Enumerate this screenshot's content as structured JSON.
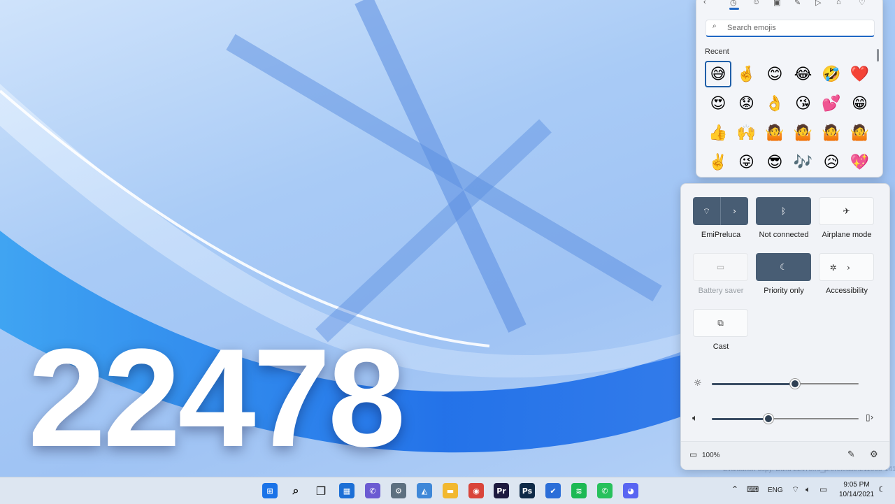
{
  "wallpaper": {
    "overlay_text": "22478"
  },
  "watermark": "Evaluation copy. Build 22478.rs_prerelease.211008-1415",
  "emoji_panel": {
    "tabs": [
      {
        "name": "back-icon",
        "glyph": "‹"
      },
      {
        "name": "recent-tab-icon",
        "glyph": "◷"
      },
      {
        "name": "smileys-tab-icon",
        "glyph": "☺"
      },
      {
        "name": "people-tab-icon",
        "glyph": "▣"
      },
      {
        "name": "celebration-tab-icon",
        "glyph": "✎"
      },
      {
        "name": "food-tab-icon",
        "glyph": "▷"
      },
      {
        "name": "travel-tab-icon",
        "glyph": "⌂"
      },
      {
        "name": "heart-tab-icon",
        "glyph": "♡"
      }
    ],
    "search_placeholder": "Search emojis",
    "section_label": "Recent",
    "emojis": [
      "😅",
      "🤞",
      "😊",
      "😂",
      "🤣",
      "❤️",
      "😍",
      "😟",
      "👌",
      "😘",
      "💕",
      "😁",
      "👍",
      "🙌",
      "🤷",
      "🤷",
      "🤷",
      "🤷",
      "✌️",
      "😜",
      "😎",
      "🎶",
      "😥",
      "💖"
    ]
  },
  "quick_settings": {
    "tiles": [
      {
        "key": "wifi",
        "label": "EmiPreluca",
        "icon": "wifi-icon",
        "glyph": "⌔",
        "state": "on",
        "has_arrow": true
      },
      {
        "key": "bluetooth",
        "label": "Not connected",
        "icon": "bluetooth-icon",
        "glyph": "ᛒ",
        "state": "on",
        "has_arrow": false
      },
      {
        "key": "airplane",
        "label": "Airplane mode",
        "icon": "airplane-icon",
        "glyph": "✈",
        "state": "off",
        "has_arrow": false
      },
      {
        "key": "battery_saver",
        "label": "Battery saver",
        "icon": "battery-saver-icon",
        "glyph": "▭",
        "state": "disabled",
        "has_arrow": false
      },
      {
        "key": "priority",
        "label": "Priority only",
        "icon": "moon-icon",
        "glyph": "☾",
        "state": "on",
        "has_arrow": false
      },
      {
        "key": "accessibility",
        "label": "Accessibility",
        "icon": "accessibility-icon",
        "glyph": "✲",
        "state": "off",
        "has_arrow": true
      },
      {
        "key": "cast",
        "label": "Cast",
        "icon": "cast-icon",
        "glyph": "⧉",
        "state": "off",
        "has_arrow": false
      }
    ],
    "brightness_level": 0.56,
    "volume_level": 0.38,
    "battery_text": "100%"
  },
  "taskbar": {
    "apps": [
      {
        "name": "start-button",
        "glyph": "⊞",
        "bg": "#1a73e8"
      },
      {
        "name": "search-icon",
        "glyph": "⌕",
        "bg": ""
      },
      {
        "name": "task-view-icon",
        "glyph": "❐",
        "bg": ""
      },
      {
        "name": "widgets-icon",
        "glyph": "▦",
        "bg": "#1c6fd6"
      },
      {
        "name": "teams-chat-icon",
        "glyph": "✆",
        "bg": "#6b5bd2"
      },
      {
        "name": "settings-icon",
        "glyph": "⚙",
        "bg": "#5d7080"
      },
      {
        "name": "photos-icon",
        "glyph": "◭",
        "bg": "#3f88d8"
      },
      {
        "name": "file-explorer-icon",
        "glyph": "▬",
        "bg": "#f2b82f"
      },
      {
        "name": "chrome-icon",
        "glyph": "◉",
        "bg": "#d9453a"
      },
      {
        "name": "premiere-pro-icon",
        "glyph": "Pr",
        "bg": "#1d1a3f"
      },
      {
        "name": "photoshop-icon",
        "glyph": "Ps",
        "bg": "#0e2a48"
      },
      {
        "name": "todo-icon",
        "glyph": "✔",
        "bg": "#2b6ed8"
      },
      {
        "name": "spotify-icon",
        "glyph": "≋",
        "bg": "#1db954"
      },
      {
        "name": "whatsapp-icon",
        "glyph": "✆",
        "bg": "#27c15c"
      },
      {
        "name": "discord-icon",
        "glyph": "◕",
        "bg": "#5865f2"
      }
    ],
    "language": "ENG",
    "time": "9:05 PM",
    "date": "10/14/2021"
  }
}
